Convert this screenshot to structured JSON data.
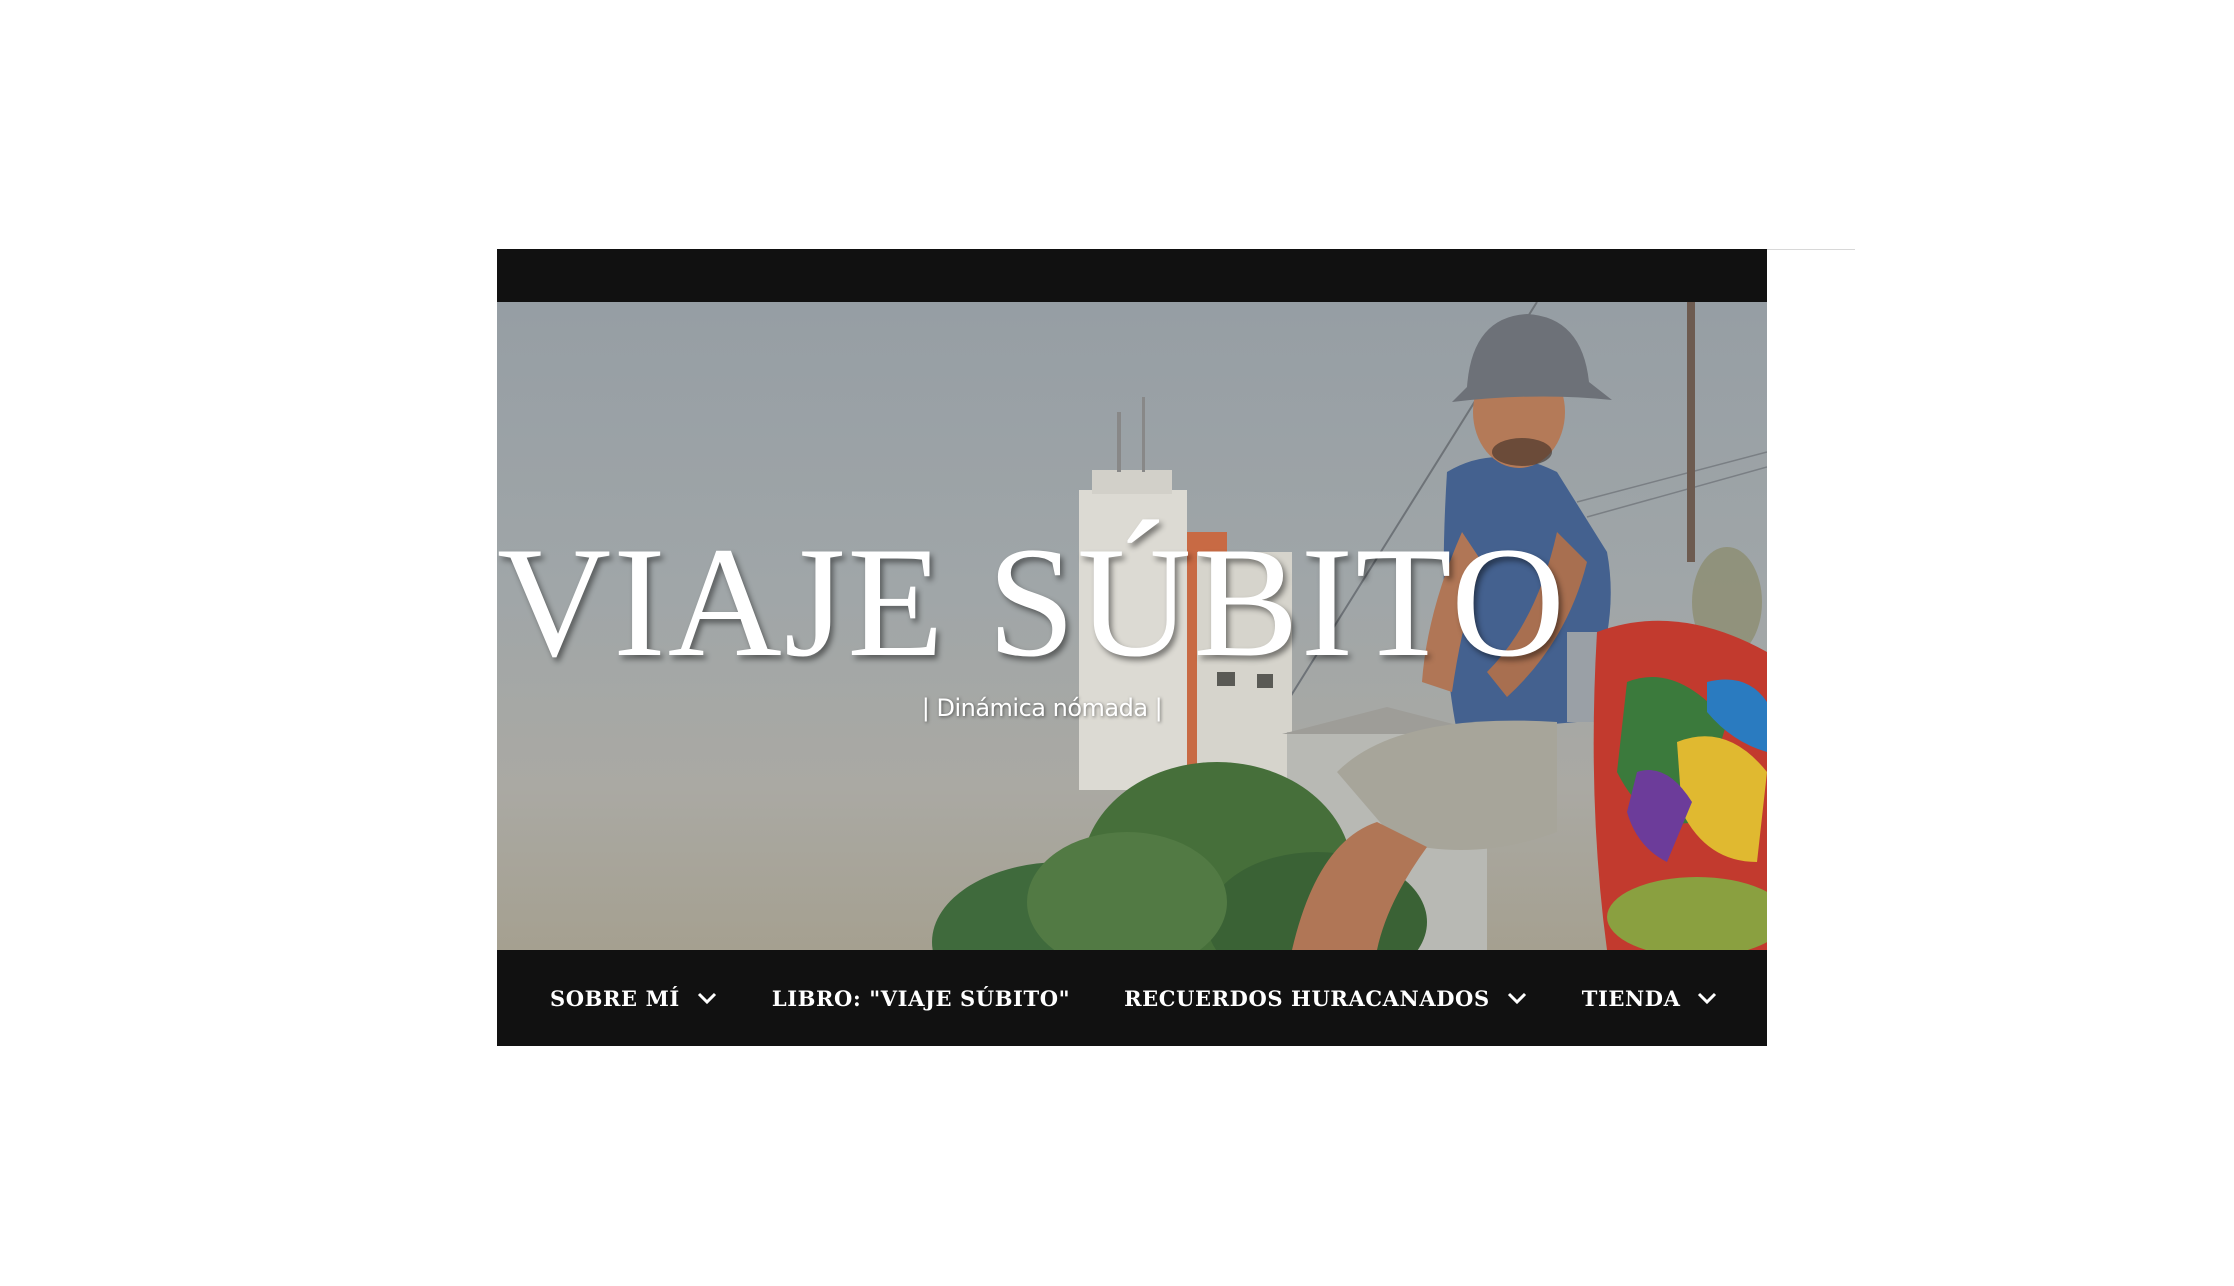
{
  "header": {
    "site_title": "VIAJE SÚBITO",
    "tagline": "| Dinámica nómada |"
  },
  "nav": {
    "items": [
      {
        "label": "SOBRE MÍ",
        "has_dropdown": true,
        "icon": "chevron-down-icon"
      },
      {
        "label": "LIBRO: \"VIAJE SÚBITO\"",
        "has_dropdown": false
      },
      {
        "label": "RECUERDOS HURACANADOS",
        "has_dropdown": true,
        "icon": "chevron-down-icon"
      },
      {
        "label": "TIENDA",
        "has_dropdown": true,
        "icon": "chevron-down-icon"
      }
    ]
  },
  "colors": {
    "header_bar": "#111111",
    "nav_text": "#ffffff",
    "page_background": "#ffffff"
  },
  "hero_image": {
    "description_icon": "header-photo"
  }
}
